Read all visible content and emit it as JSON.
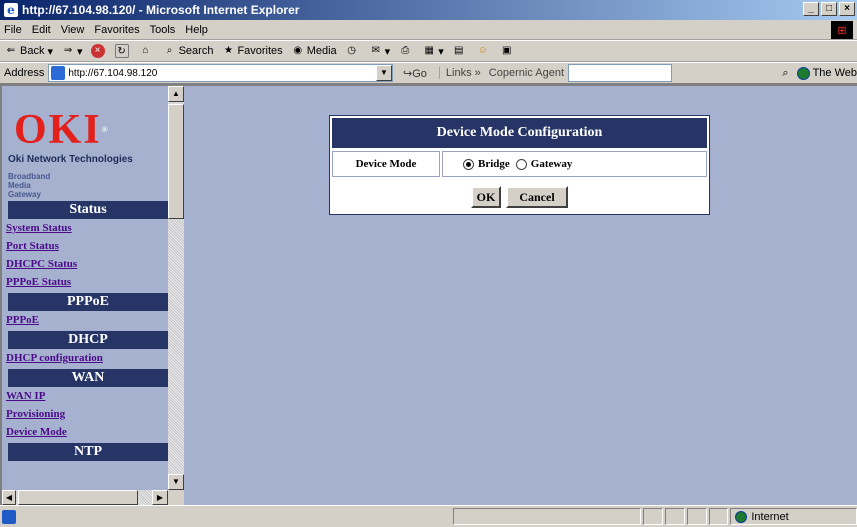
{
  "window": {
    "title": "http://67.104.98.120/ - Microsoft Internet Explorer"
  },
  "menu": [
    "File",
    "Edit",
    "View",
    "Favorites",
    "Tools",
    "Help"
  ],
  "toolbar": {
    "back": "Back",
    "search": "Search",
    "favorites": "Favorites",
    "media": "Media"
  },
  "address": {
    "label": "Address",
    "url": "http://67.104.98.120",
    "go": "Go",
    "links": "Links",
    "copernic": "Copernic Agent",
    "search_engine": "The Web"
  },
  "sidebar": {
    "logo": "OKI",
    "tagline": "Oki Network Technologies",
    "product_line1": "Broadband",
    "product_line2": "Media",
    "product_line3": "Gateway",
    "sections": [
      {
        "title": "Status",
        "links": [
          "System Status",
          "Port Status",
          "DHCPC Status",
          "PPPoE Status"
        ]
      },
      {
        "title": "PPPoE",
        "links": [
          "PPPoE"
        ]
      },
      {
        "title": "DHCP",
        "links": [
          "DHCP configuration"
        ]
      },
      {
        "title": "WAN",
        "links": [
          "WAN IP",
          "Provisioning",
          "Device Mode"
        ]
      },
      {
        "title": "NTP",
        "links": []
      }
    ]
  },
  "panel": {
    "title": "Device Mode Configuration",
    "field_label": "Device Mode",
    "options": [
      "Bridge",
      "Gateway"
    ],
    "selected": "Bridge",
    "ok": "OK",
    "cancel": "Cancel"
  },
  "status": {
    "zone": "Internet"
  }
}
